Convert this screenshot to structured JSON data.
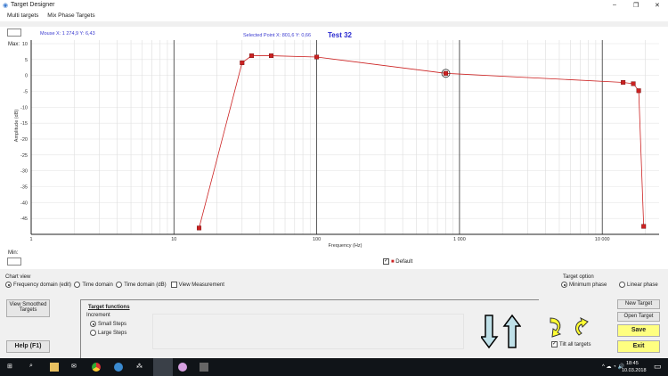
{
  "window": {
    "title": "Target Designer",
    "controls": [
      "–",
      "❐",
      "✕"
    ]
  },
  "menu": [
    "Multi targets",
    "Mix Phase Targets"
  ],
  "readout": {
    "mouse": "Mouse  X: 1 274,9   Y: 6,43",
    "selected": "Selected Point   X: 801,6   Y: 0,66",
    "name": "Test 32"
  },
  "labels": {
    "max": "Max:",
    "min": "Min:"
  },
  "chart_data": {
    "type": "line",
    "xscale": "log",
    "xlabel": "Frequency (Hz)",
    "ylabel": "Amplitude (dB)",
    "xlim": [
      1,
      25000
    ],
    "ylim": [
      -50,
      10
    ],
    "x_ticks": [
      "1",
      "10",
      "100",
      "1 000",
      "10 000"
    ],
    "x_tick_values": [
      1,
      10,
      100,
      1000,
      10000
    ],
    "y_ticks": [
      "10",
      "5",
      "0",
      "-5",
      "-10",
      "-15",
      "-20",
      "-25",
      "-30",
      "-35",
      "-40",
      "-45"
    ],
    "series": [
      {
        "name": "Default",
        "color": "#cc2222",
        "x": [
          15,
          30,
          35,
          48,
          100,
          801.6,
          14000,
          16500,
          18000,
          19500
        ],
        "y": [
          -48,
          4,
          6.2,
          6.2,
          5.8,
          0.66,
          -2.2,
          -2.6,
          -4.8,
          -47.5
        ]
      }
    ],
    "selected_index": 5,
    "legend": "bottom-center"
  },
  "chart_view": {
    "title": "Chart view",
    "options": [
      "Frequency domain (edit)",
      "Time domain",
      "Time domain (dB)"
    ],
    "selected": 0,
    "view_measurement": "View Measurement"
  },
  "target_option": {
    "title": "Target option",
    "options": [
      "Minimum phase",
      "Linear phase"
    ],
    "selected": 0
  },
  "buttons": {
    "smoothed": "View Smoothed Targets",
    "help": "Help (F1)",
    "new": "New Target",
    "open": "Open Target",
    "save": "Save",
    "exit": "Exit"
  },
  "target_functions": {
    "title": "Target functions",
    "increment": "Increment",
    "options": [
      "Small Steps",
      "Large Steps"
    ],
    "selected": 0,
    "tilt": "Tilt all targets"
  },
  "taskbar": {
    "time": "18:45",
    "date": "10.03.2018"
  }
}
